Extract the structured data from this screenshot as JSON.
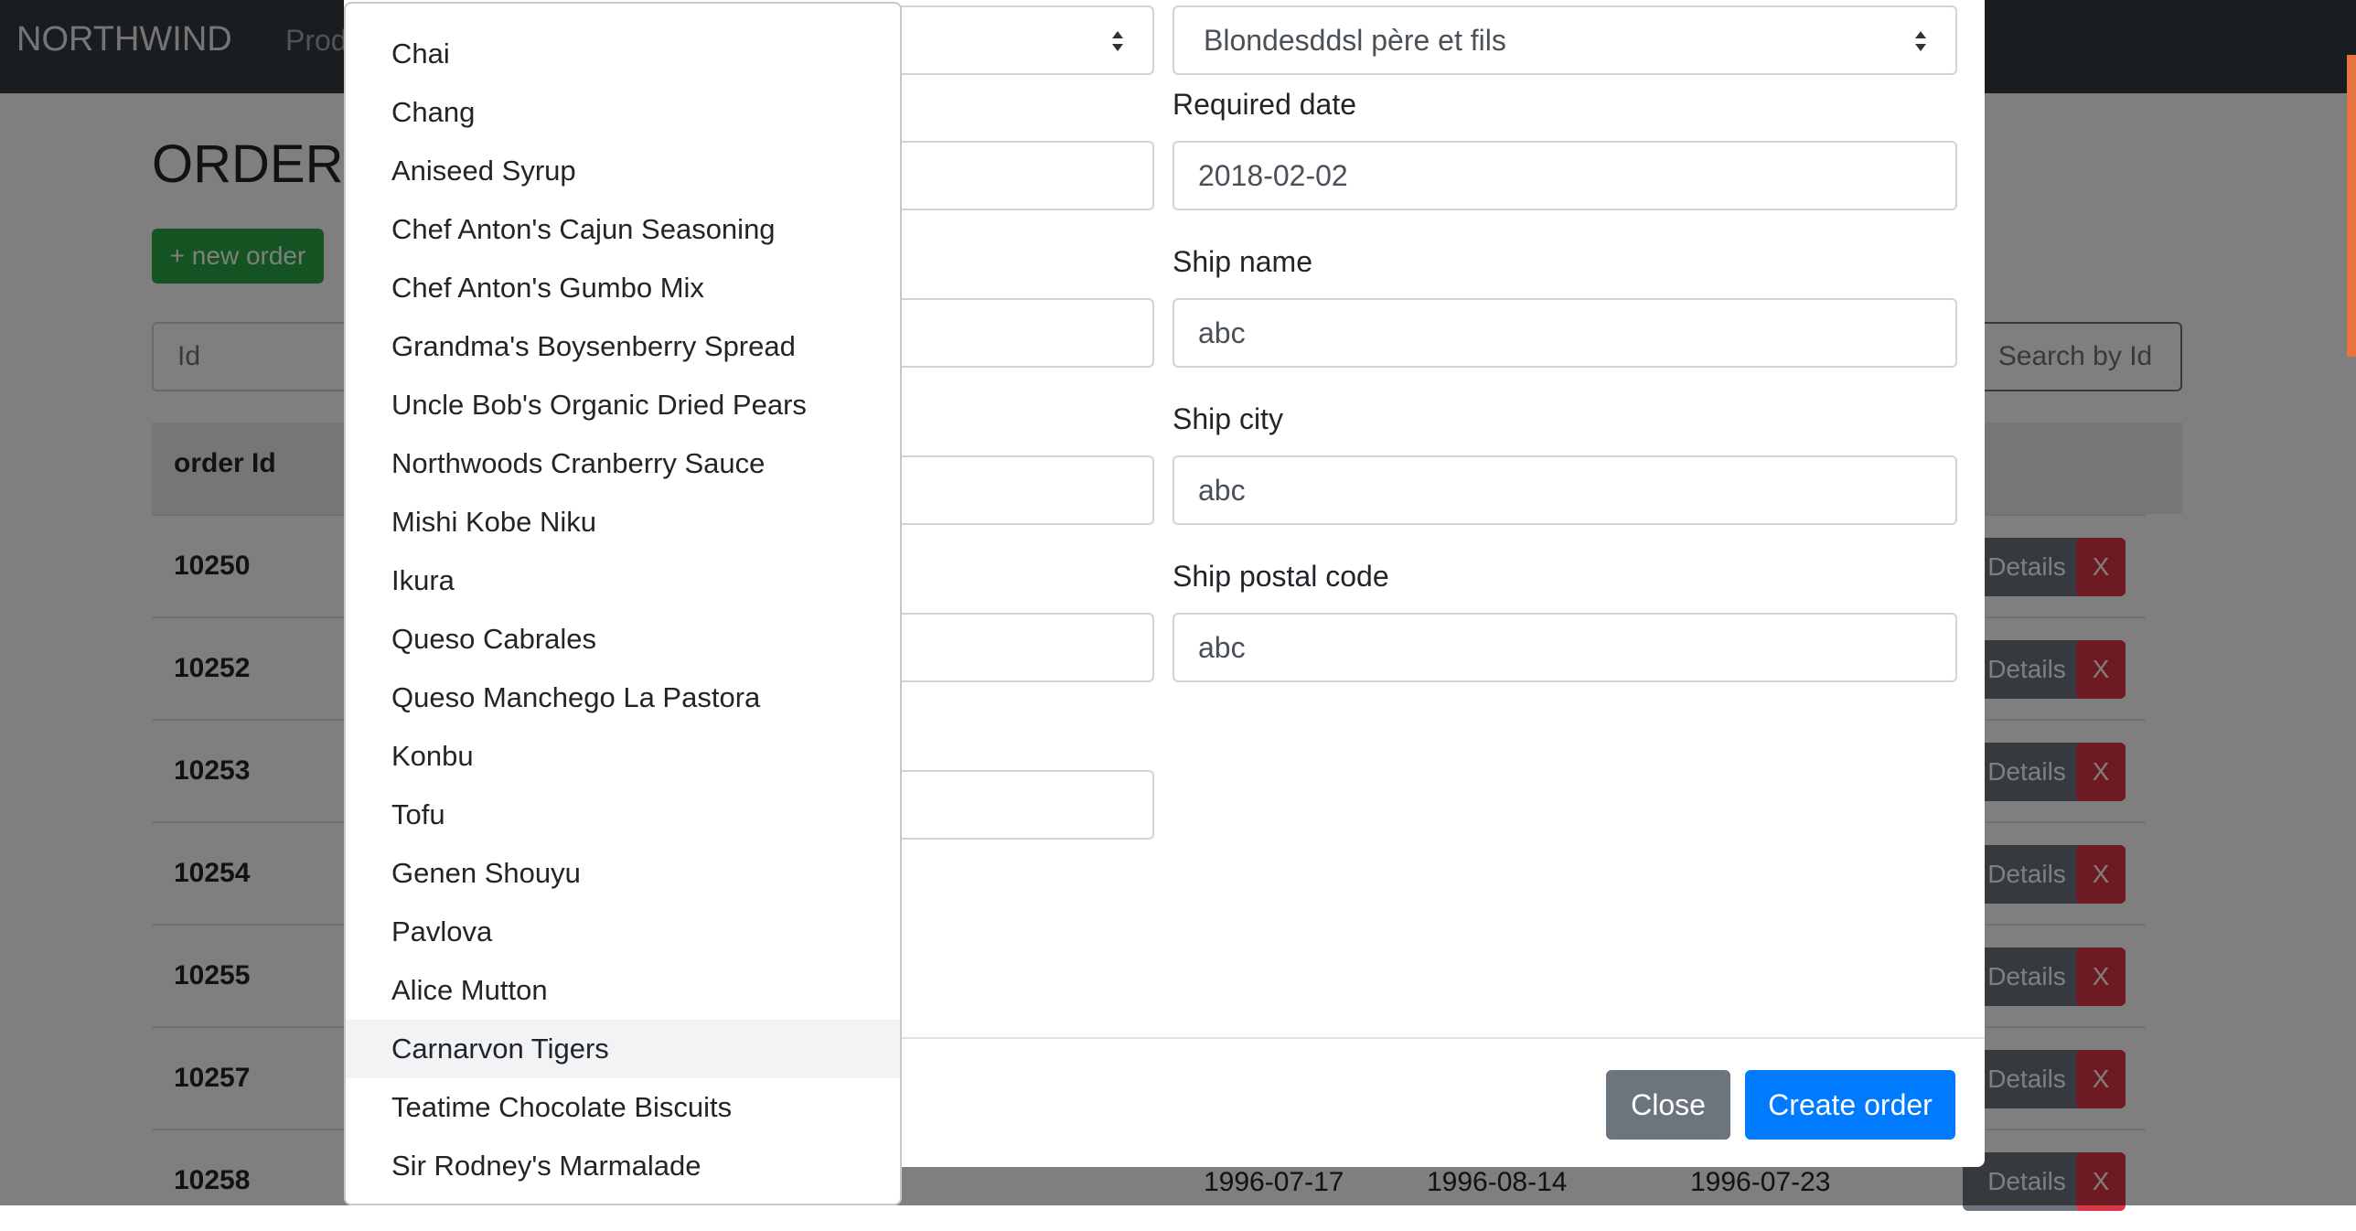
{
  "navbar": {
    "brand": "NORTHWIND",
    "nav_partial": "Prod"
  },
  "page": {
    "title_partial": "ORDERS",
    "new_order_label": "+ new order",
    "search_placeholder": "Id",
    "search_button_label": "Search by Id",
    "table_header_id": "order Id",
    "details_label": "Details",
    "delete_label": "X",
    "rows": [
      {
        "id": "10250"
      },
      {
        "id": "10252"
      },
      {
        "id": "10253"
      },
      {
        "id": "10254"
      },
      {
        "id": "10255"
      },
      {
        "id": "10257"
      },
      {
        "id": "10258",
        "order_date": "1996-07-17",
        "required_date": "1996-08-14",
        "shipped_date": "1996-07-23"
      }
    ]
  },
  "modal": {
    "customer_select_value": "Blondesddsl père et fils",
    "required_date_label": "Required date",
    "required_date_value": "2018-02-02",
    "ship_name_label": "Ship name",
    "ship_name_value": "abc",
    "ship_city_label": "Ship city",
    "ship_city_value": "abc",
    "ship_postal_code_label": "Ship postal code",
    "ship_postal_code_value": "abc",
    "close_label": "Close",
    "create_label": "Create order"
  },
  "dropdown": {
    "highlighted_index": 17,
    "options": [
      "Chai",
      "Chang",
      "Aniseed Syrup",
      "Chef Anton's Cajun Seasoning",
      "Chef Anton's Gumbo Mix",
      "Grandma's Boysenberry Spread",
      "Uncle Bob's Organic Dried Pears",
      "Northwoods Cranberry Sauce",
      "Mishi Kobe Niku",
      "Ikura",
      "Queso Cabrales",
      "Queso Manchego La Pastora",
      "Konbu",
      "Tofu",
      "Genen Shouyu",
      "Pavlova",
      "Alice Mutton",
      "Carnarvon Tigers",
      "Teatime Chocolate Biscuits",
      "Sir Rodney's Marmalade"
    ]
  },
  "colors": {
    "navbar": "#343a40",
    "success": "#28a745",
    "danger": "#dc3545",
    "secondary": "#6c757d",
    "primary": "#007bff",
    "scrollbar_accent": "#e7743e"
  }
}
